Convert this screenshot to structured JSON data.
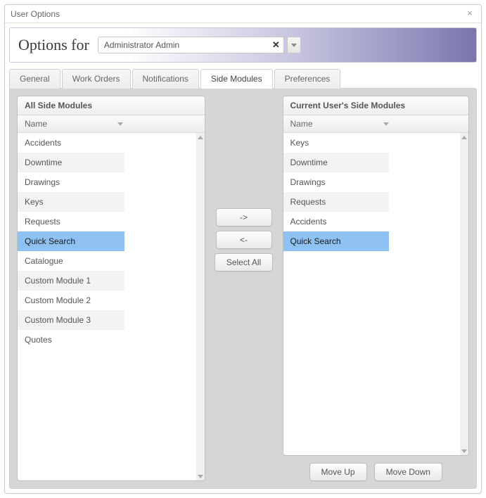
{
  "window": {
    "title": "User Options"
  },
  "banner": {
    "label": "Options for",
    "user": "Administrator Admin"
  },
  "tabs": [
    {
      "label": "General"
    },
    {
      "label": "Work Orders"
    },
    {
      "label": "Notifications"
    },
    {
      "label": "Side Modules",
      "active": true
    },
    {
      "label": "Preferences"
    }
  ],
  "left_panel": {
    "title": "All Side Modules",
    "column": "Name",
    "items": [
      {
        "label": "Accidents"
      },
      {
        "label": "Downtime",
        "alt": true
      },
      {
        "label": "Drawings"
      },
      {
        "label": "Keys",
        "alt": true
      },
      {
        "label": "Requests"
      },
      {
        "label": "Quick Search",
        "selected": true
      },
      {
        "label": "Catalogue"
      },
      {
        "label": "Custom Module 1",
        "alt": true
      },
      {
        "label": "Custom Module 2"
      },
      {
        "label": "Custom Module 3",
        "alt": true
      },
      {
        "label": "Quotes"
      }
    ]
  },
  "mid_buttons": {
    "add": "->",
    "remove": "<-",
    "select_all": "Select All"
  },
  "right_panel": {
    "title": "Current User's Side Modules",
    "column": "Name",
    "items": [
      {
        "label": "Keys"
      },
      {
        "label": "Downtime",
        "alt": true
      },
      {
        "label": "Drawings"
      },
      {
        "label": "Requests",
        "alt": true
      },
      {
        "label": "Accidents"
      },
      {
        "label": "Quick Search",
        "selected": true
      }
    ]
  },
  "footer": {
    "move_up": "Move Up",
    "move_down": "Move Down"
  }
}
